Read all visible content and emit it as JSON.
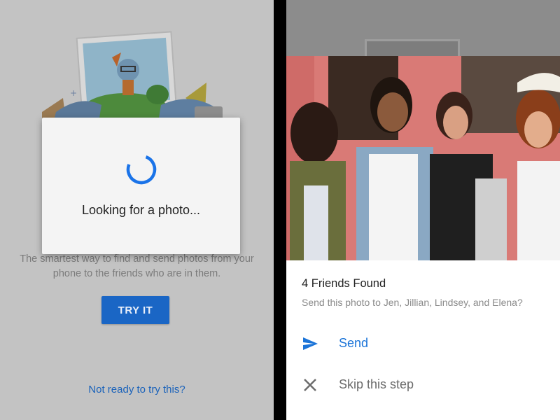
{
  "colors": {
    "accent": "#1a73e8",
    "button_bg": "#1a66c5",
    "link": "#1a62ba",
    "left_bg": "#c3c3c3"
  },
  "left_screen": {
    "illustration": "photo-frame-with-cartoon-character",
    "intro_text": "The smartest way to find and send photos from your phone to the friends who are in them.",
    "try_button_label": "TRY IT",
    "not_ready_link": "Not ready to try this?",
    "loading_dialog": {
      "spinner": "loading-spinner",
      "text": "Looking for a photo..."
    }
  },
  "right_screen": {
    "photo": "group-photo-four-friends",
    "found_title": "4 Friends Found",
    "found_subtitle": "Send this photo to Jen, Jillian, Lindsey, and Elena?",
    "actions": [
      {
        "icon": "send-icon",
        "label": "Send"
      },
      {
        "icon": "close-icon",
        "label": "Skip this step"
      }
    ]
  }
}
